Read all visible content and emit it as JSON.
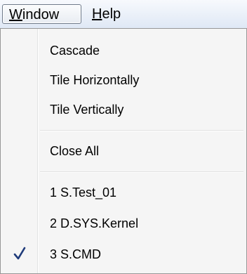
{
  "menubar": {
    "window_mnemonic": "W",
    "window_rest": "indow",
    "help_mnemonic": "H",
    "help_rest": "elp"
  },
  "menu": {
    "items": [
      {
        "label": "Cascade"
      },
      {
        "label": "Tile Horizontally"
      },
      {
        "label": "Tile Vertically"
      },
      {
        "label": "Close All"
      },
      {
        "label": "1 S.Test_01"
      },
      {
        "label": "2 D.SYS.Kernel"
      },
      {
        "label": "3 S.CMD",
        "checked": true
      }
    ]
  },
  "colors": {
    "checkmark": "#1f3b7a"
  },
  "icons": {
    "checked_item": "checkmark-icon"
  }
}
